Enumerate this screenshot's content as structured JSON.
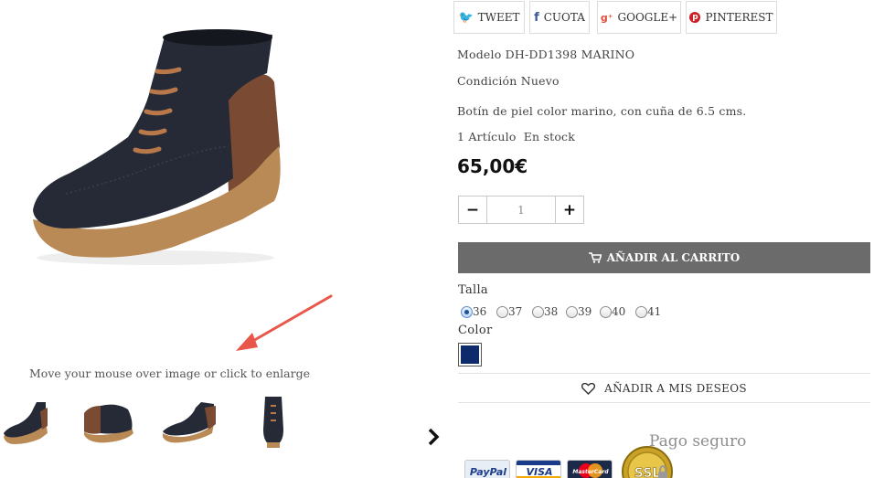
{
  "share": {
    "tweet": "TWEET",
    "share": "CUOTA",
    "google": "GOOGLE+",
    "pinterest": "PINTEREST"
  },
  "product": {
    "model_label": "Modelo",
    "model_value": "DH-DD1398 MARINO",
    "condition_label": "Condición",
    "condition_value": "Nuevo",
    "description": "Botín de piel color marino, con cuña de 6.5 cms.",
    "stock_count": "1",
    "stock_unit": "Artículo",
    "stock_status": "En stock",
    "price": "65,00€"
  },
  "quantity": {
    "value": "1",
    "minus": "−",
    "plus": "+"
  },
  "add_to_cart": "AÑADIR AL CARRITO",
  "size": {
    "label": "Talla",
    "options": [
      "36",
      "37",
      "38",
      "39",
      "40",
      "41"
    ],
    "selected": "36"
  },
  "color": {
    "label": "Color",
    "swatch": "#0d2a6b"
  },
  "wishlist": "AÑADIR A MIS DESEOS",
  "gallery": {
    "hint": "Move your mouse over image or click to enlarge"
  },
  "secure": {
    "title": "Pago seguro",
    "cards": [
      "PayPal",
      "VISA",
      "MasterCard"
    ],
    "badge": "SSL"
  },
  "colors": {
    "boot_navy": "#262a36",
    "boot_brown": "#7a4a33",
    "sole": "#b98a55",
    "button_gray": "#6b6b6b",
    "annotation_red": "#e8574a",
    "twitter": "#1da1f2",
    "facebook": "#3b5998",
    "google": "#dd4b39",
    "pinterest": "#cb2027"
  }
}
